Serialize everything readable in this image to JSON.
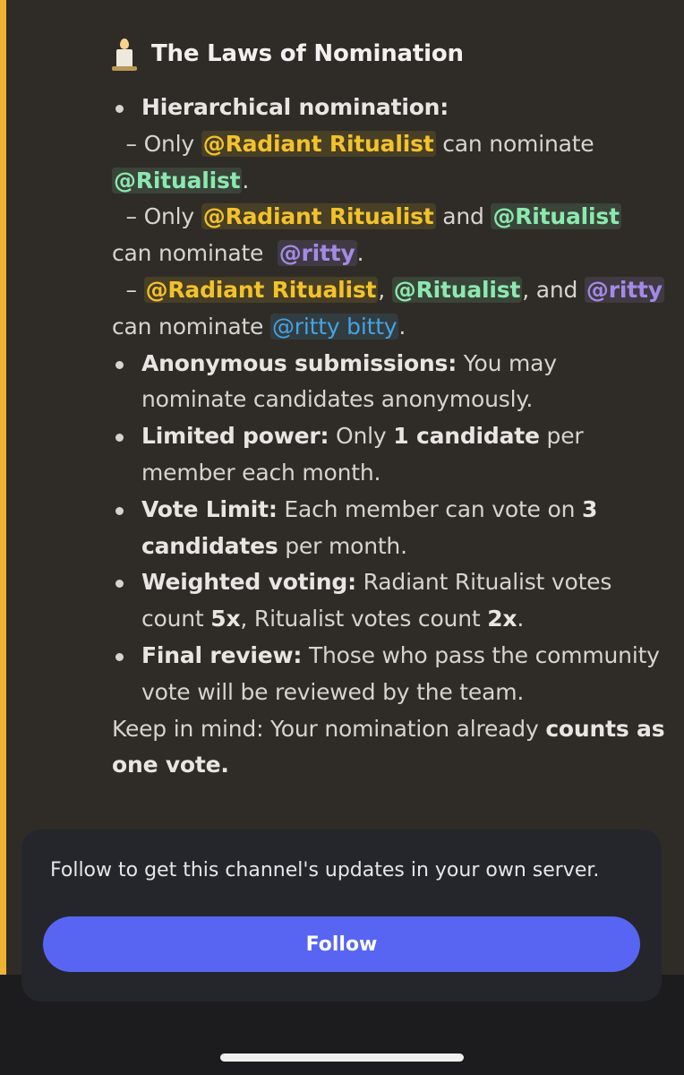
{
  "colors": {
    "background": "#2f2c27",
    "accent_bar": "#f0b232",
    "follow_button": "#5865f2",
    "mention_radiant": "#f3c22a",
    "mention_ritualist": "#8ce8b0",
    "mention_ritty": "#a48ae6",
    "mention_ritty_bitty": "#46a3e0"
  },
  "title": {
    "icon": "candle-icon",
    "text": "The Laws of Nomination"
  },
  "mentions": {
    "radiant": "@Radiant Ritualist",
    "ritualist": "@Ritualist",
    "ritty": "@ritty",
    "ritty_bitty": "@ritty bitty"
  },
  "laws": {
    "hier_label": "Hierarchical nomination:",
    "dash": "–",
    "only": "Only",
    "can_nominate": "can nominate",
    "and": "and",
    "comma_and": ", and",
    "comma": ",",
    "period": ".",
    "anon_label": "Anonymous submissions:",
    "anon_text": "You may nominate candidates anonymously.",
    "limited_label": "Limited power:",
    "limited_text1": "Only",
    "limited_bold": "1 candidate",
    "limited_text2": "per member each month.",
    "vote_label": "Vote Limit:",
    "vote_text1": "Each member can vote on",
    "vote_bold": "3 candidates",
    "vote_text2": "per month.",
    "weighted_label": "Weighted voting:",
    "weighted_text1": "Radiant Ritualist votes count",
    "weighted_bold1": "5x",
    "weighted_text2": ", Ritualist votes count",
    "weighted_bold2": "2x",
    "final_label": "Final review:",
    "final_text": "Those who pass the community vote will be reviewed by the team."
  },
  "footer_note": {
    "text": "Keep in mind: Your nomination already",
    "bold": "counts as one vote."
  },
  "follow": {
    "text": "Follow to get this channel's updates in your own server.",
    "button_label": "Follow"
  }
}
